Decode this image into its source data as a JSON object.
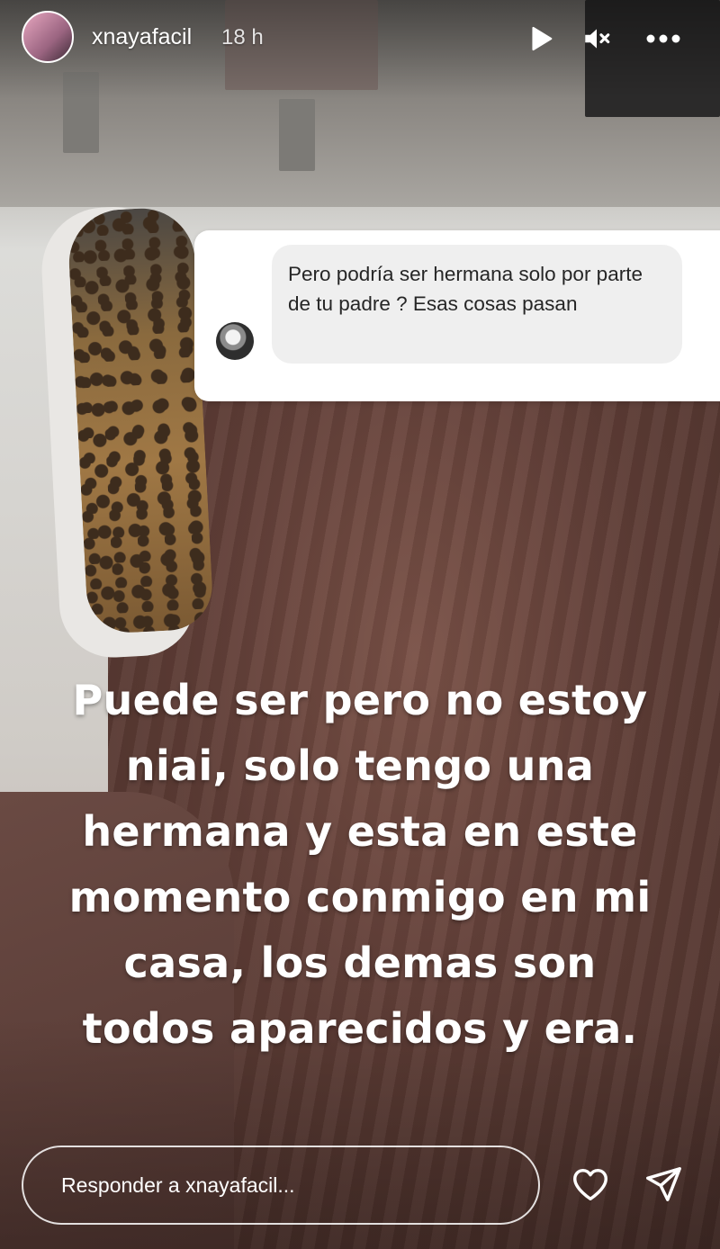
{
  "header": {
    "username": "xnayafacil",
    "timestamp": "18 h",
    "icons": [
      "avatar",
      "play-icon",
      "mute-icon",
      "more-options-icon"
    ]
  },
  "question_sticker": {
    "text": "Pero podría ser hermana solo por parte de tu padre ? Esas cosas pasan"
  },
  "story": {
    "text_lines": [
      "Puede ser pero no estoy",
      "niai, solo tengo una",
      "hermana y esta en este",
      "momento conmigo en mi",
      "casa, los demas son",
      "todos aparecidos y era."
    ]
  },
  "footer": {
    "reply_placeholder": "Responder a xnayafacil...",
    "icons": [
      "heart-icon",
      "send-icon"
    ]
  },
  "colors": {
    "text": "#ffffff",
    "bubble_bg": "#efefef",
    "bubble_text": "#262626",
    "card_bg": "#ffffff"
  }
}
